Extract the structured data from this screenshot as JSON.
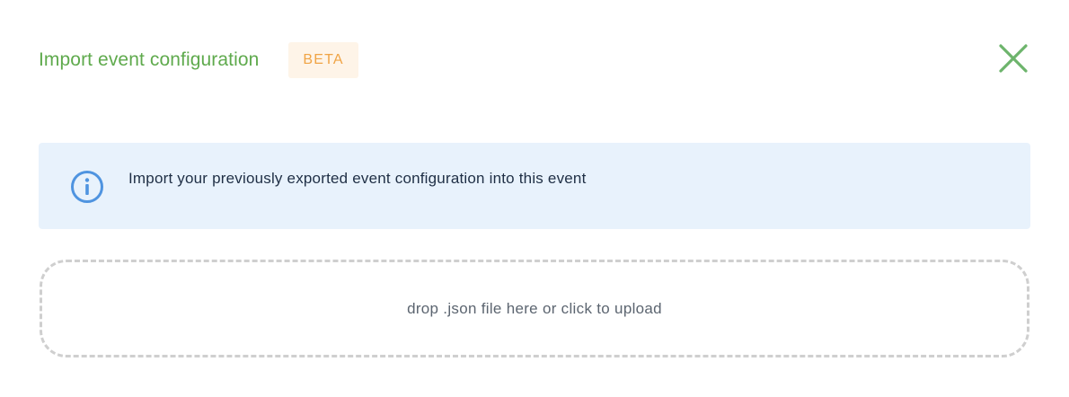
{
  "dialog": {
    "title": "Import event configuration",
    "badge": "BETA",
    "close_icon": "close-icon"
  },
  "info": {
    "icon": "info-icon",
    "text": "Import your previously exported event configuration into this event"
  },
  "dropzone": {
    "text": "drop .json file here or click to upload"
  },
  "colors": {
    "title": "#5faa4d",
    "badge_bg": "#fef4e8",
    "badge_text": "#f0a445",
    "info_bg": "#e8f2fc",
    "info_icon": "#4f94e0",
    "dropzone_border": "#cfcfcf"
  }
}
